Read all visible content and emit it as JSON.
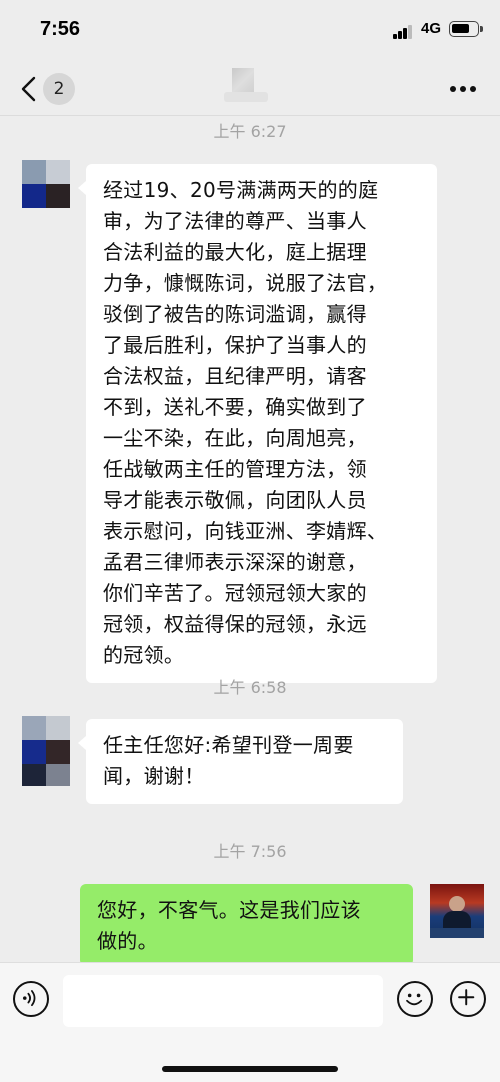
{
  "status_bar": {
    "time": "7:56",
    "network": "4G"
  },
  "nav": {
    "back_icon": "chevron-left-icon",
    "unread_count": "2",
    "more_icon": "ellipsis-icon"
  },
  "messages": [
    {
      "time": "上午 6:27",
      "side": "left",
      "text": "经过19、20号满满两天的的庭\n审，为了法律的尊严、当事人\n合法利益的最大化，庭上据理\n力争，慷慨陈词，说服了法官，\n驳倒了被告的陈词滥调，赢得\n了最后胜利，保护了当事人的\n合法权益，且纪律严明，请客\n不到，送礼不要，确实做到了\n一尘不染，在此，向周旭亮，\n任战敏两主任的管理方法，领\n导才能表示敬佩，向团队人员\n表示慰问，向钱亚洲、李婧辉、\n孟君三律师表示深深的谢意，\n你们辛苦了。冠领冠领大家的\n冠领，权益得保的冠领，永远\n的冠领。"
    },
    {
      "time": "上午 6:58",
      "side": "left",
      "text": "任主任您好:希望刊登一周要\n闻，谢谢！"
    },
    {
      "time": "上午 7:56",
      "side": "right",
      "text": "您好，不客气。这是我们应该\n做的。"
    }
  ],
  "input_bar": {
    "voice_icon": "voice-icon",
    "emoji_icon": "emoji-icon",
    "plus_icon": "plus-icon",
    "placeholder": ""
  },
  "colors": {
    "background": "#ededed",
    "bubble_left": "#ffffff",
    "bubble_right": "#95ec69",
    "timestamp": "#a3a3a3"
  }
}
